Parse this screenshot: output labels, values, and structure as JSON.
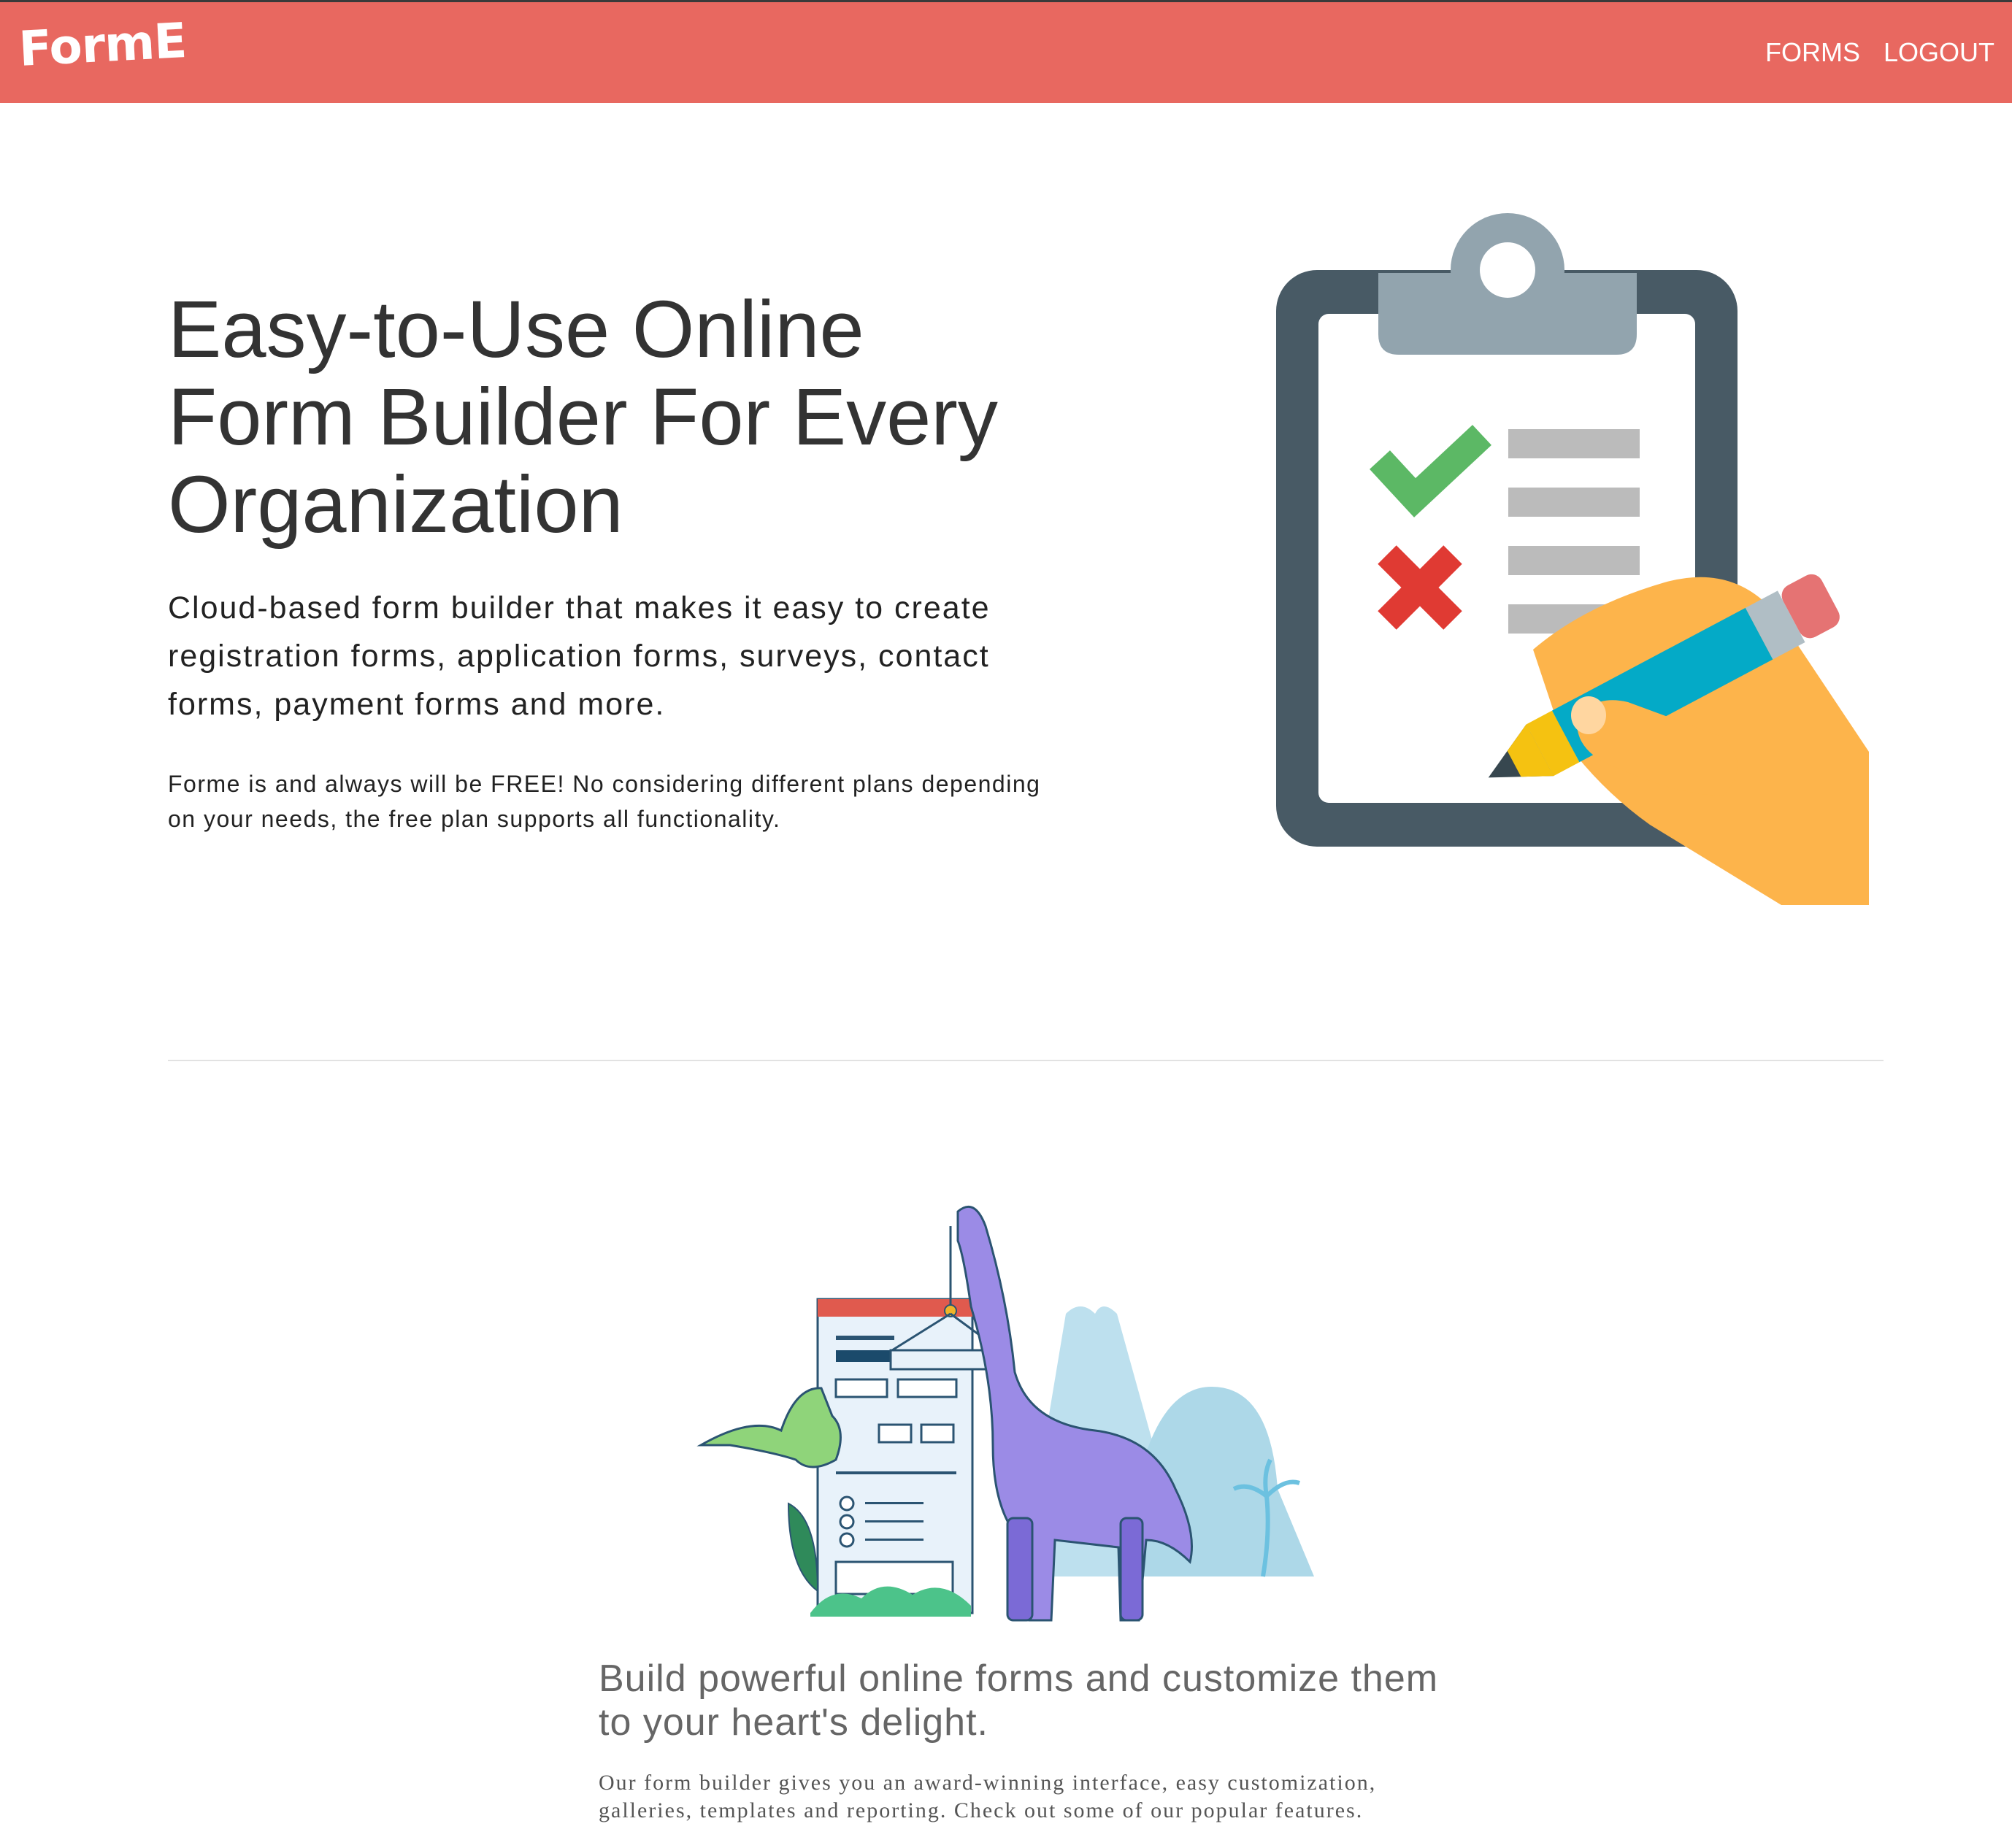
{
  "navbar": {
    "brand": "FormE",
    "links": [
      {
        "label": "FORMS"
      },
      {
        "label": "LOGOUT"
      }
    ],
    "background_color": "#e86860"
  },
  "hero": {
    "title": "Easy-to-Use Online Form Builder For Every Organization",
    "lead": "Cloud-based form builder that makes it easy to create registration forms, application forms, surveys, contact forms, payment forms and more.",
    "note": "Forme is and always will be FREE! No considering different plans depending on your needs, the free plan supports all functionality.",
    "illustration": "clipboard-checklist-with-hand-and-pencil"
  },
  "features": {
    "illustration": "dinosaur-building-form",
    "heading": "Build powerful online forms and customize them to your heart's delight.",
    "text": "Our form builder gives you an award-winning interface, easy customization, galleries, templates and reporting. Check out some of our popular features."
  }
}
